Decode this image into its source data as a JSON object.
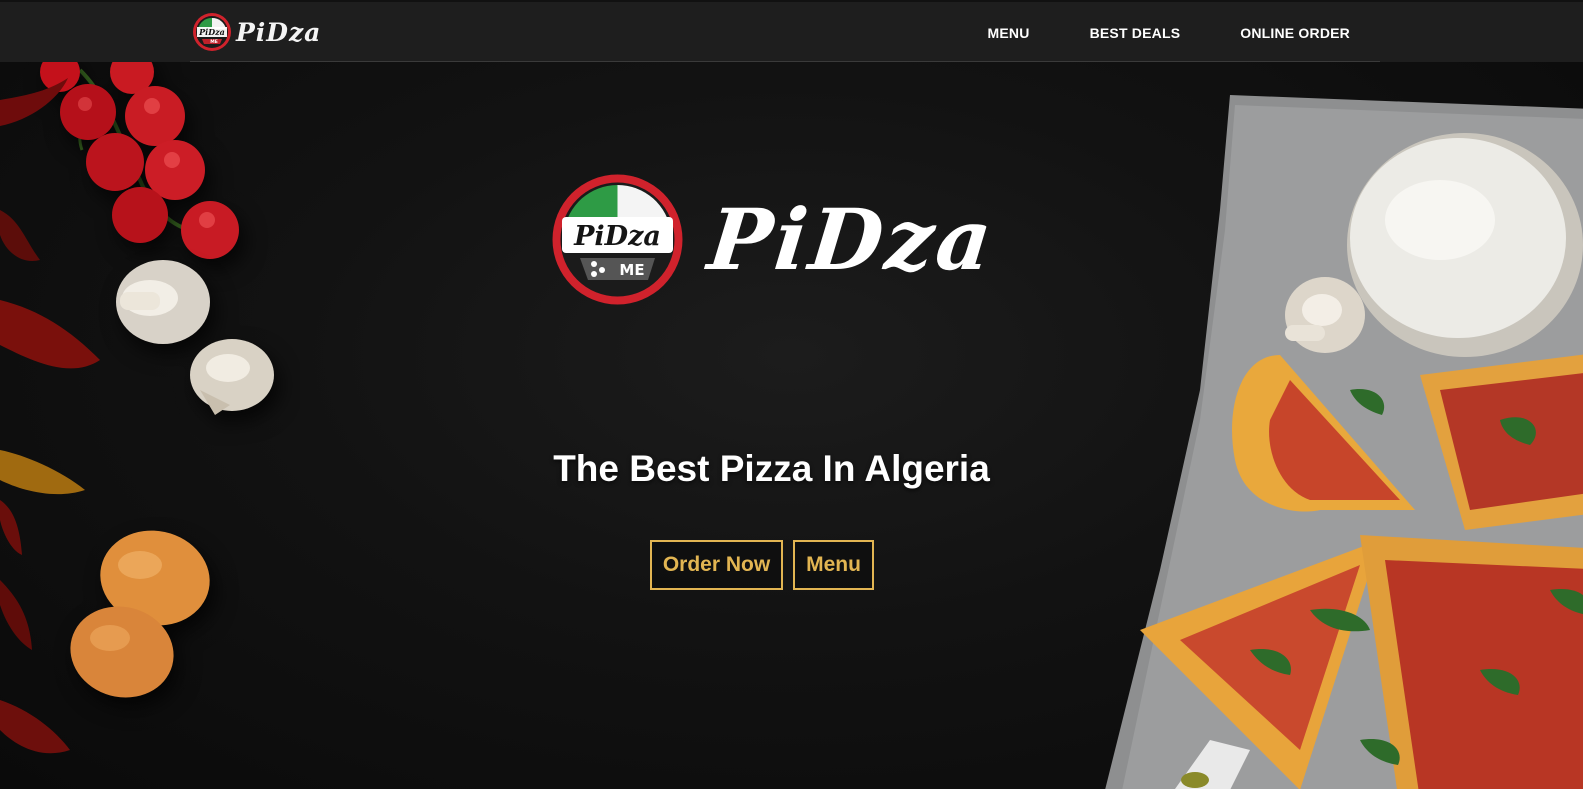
{
  "brand": {
    "name": "PiDza",
    "badge_top": "PiDza",
    "badge_bottom": "ME"
  },
  "nav": {
    "items": [
      {
        "label": "MENU"
      },
      {
        "label": "BEST DEALS"
      },
      {
        "label": "ONLINE ORDER"
      }
    ]
  },
  "hero": {
    "title": "The Best Pizza In Algeria",
    "buttons": {
      "order": "Order Now",
      "menu": "Menu"
    }
  },
  "colors": {
    "navbar_bg": "#1e1e1e",
    "page_bg": "#121212",
    "accent_gold": "#e2b552",
    "badge_red": "#d0222c",
    "badge_green": "#2e9b45"
  },
  "icons": {
    "brand_logo": "pidza-badge-icon"
  }
}
